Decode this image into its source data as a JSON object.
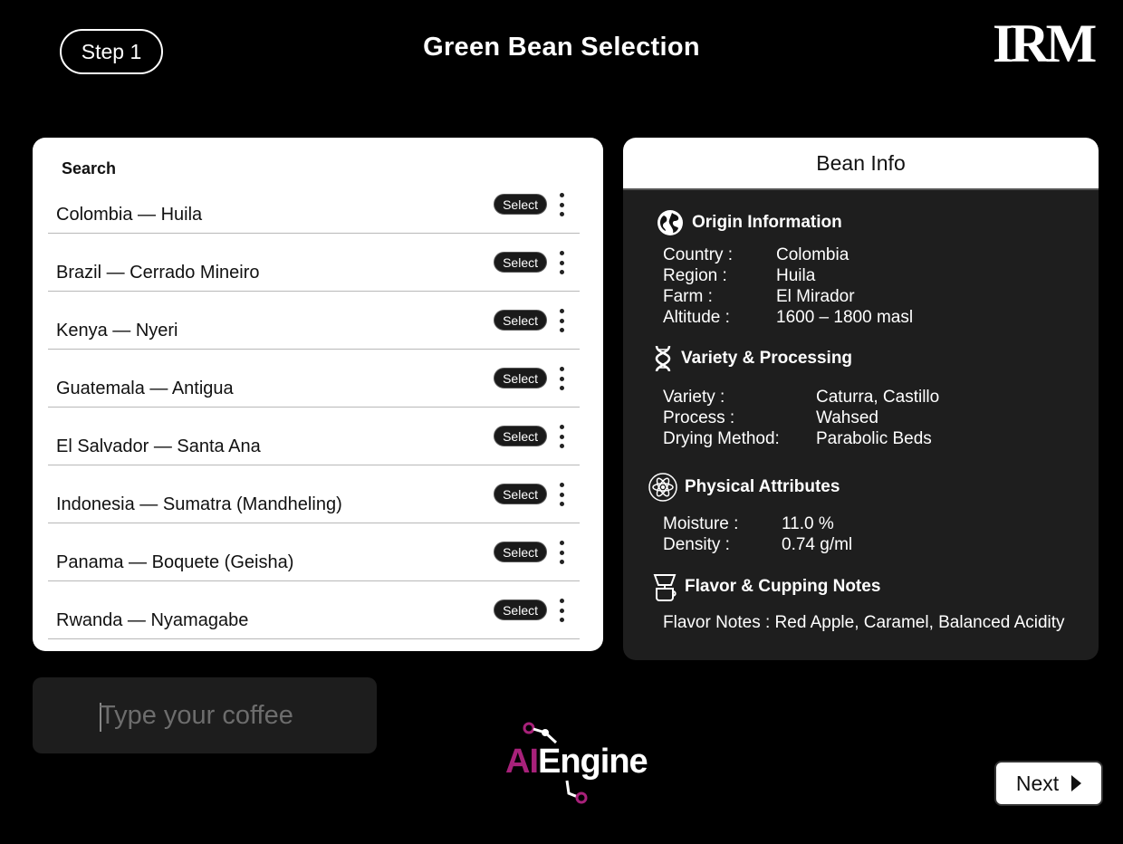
{
  "header": {
    "step_label": "Step 1",
    "title": "Green Bean Selection",
    "logo_text": "IRM"
  },
  "search": {
    "label": "Search",
    "select_label": "Select",
    "items": [
      {
        "label": "Colombia — Huila"
      },
      {
        "label": "Brazil — Cerrado Mineiro"
      },
      {
        "label": "Kenya — Nyeri"
      },
      {
        "label": "Guatemala — Antigua"
      },
      {
        "label": "El Salvador — Santa Ana"
      },
      {
        "label": "Indonesia — Sumatra (Mandheling)"
      },
      {
        "label": "Panama — Boquete (Geisha)"
      },
      {
        "label": "Rwanda — Nyamagabe"
      }
    ]
  },
  "bean_info": {
    "title": "Bean Info",
    "origin": {
      "heading": "Origin Information",
      "icon": "globe-icon",
      "country_key": "Country :",
      "country_value": "Colombia",
      "region_key": "Region :",
      "region_value": "Huila",
      "farm_key": "Farm :",
      "farm_value": "El Mirador",
      "altitude_key": "Altitude :",
      "altitude_value": "1600 – 1800 masl"
    },
    "variety": {
      "heading": "Variety & Processing",
      "icon": "dna-icon",
      "variety_key": "Variety :",
      "variety_value": "Caturra, Castillo",
      "process_key": "Process :",
      "process_value": "Wahsed",
      "drying_key": "Drying Method:",
      "drying_value": "Parabolic Beds"
    },
    "physical": {
      "heading": "Physical Attributes",
      "icon": "atom-icon",
      "moisture_key": "Moisture :",
      "moisture_value": "11.0 %",
      "density_key": "Density :",
      "density_value": "0.74 g/ml"
    },
    "flavor": {
      "heading": "Flavor & Cupping Notes",
      "icon": "coffee-dripper-icon",
      "notes": "Flavor Notes : Red Apple, Caramel, Balanced Acidity"
    }
  },
  "input": {
    "placeholder": "Type your coffee",
    "value": ""
  },
  "engine_logo": {
    "ai": "AI",
    "engine": "Engine"
  },
  "footer": {
    "next_label": "Next"
  },
  "colors": {
    "background": "#000000",
    "panel_dark": "#1e1e1e",
    "accent": "#a8217a"
  }
}
